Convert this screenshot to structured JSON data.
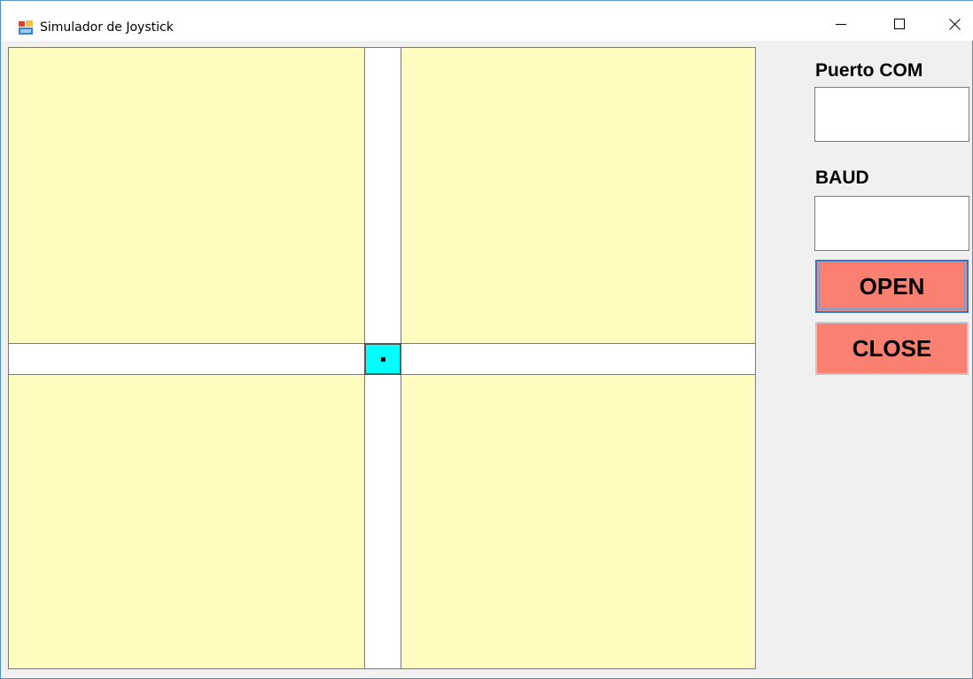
{
  "window": {
    "title": "Simulador de Joystick",
    "app_icon": "winforms-app-icon",
    "controls": {
      "minimize": "minimize-icon",
      "maximize": "maximize-icon",
      "close": "close-icon"
    }
  },
  "joystick": {
    "quadrant_color": "#fffcc0",
    "axis_color": "#ffffff",
    "knob_color": "#00ffff"
  },
  "side_panel": {
    "port_label": "Puerto COM",
    "port_value": "",
    "baud_label": "BAUD",
    "baud_value": "",
    "open_button": "OPEN",
    "close_button": "CLOSE",
    "button_color": "#fa8072"
  }
}
